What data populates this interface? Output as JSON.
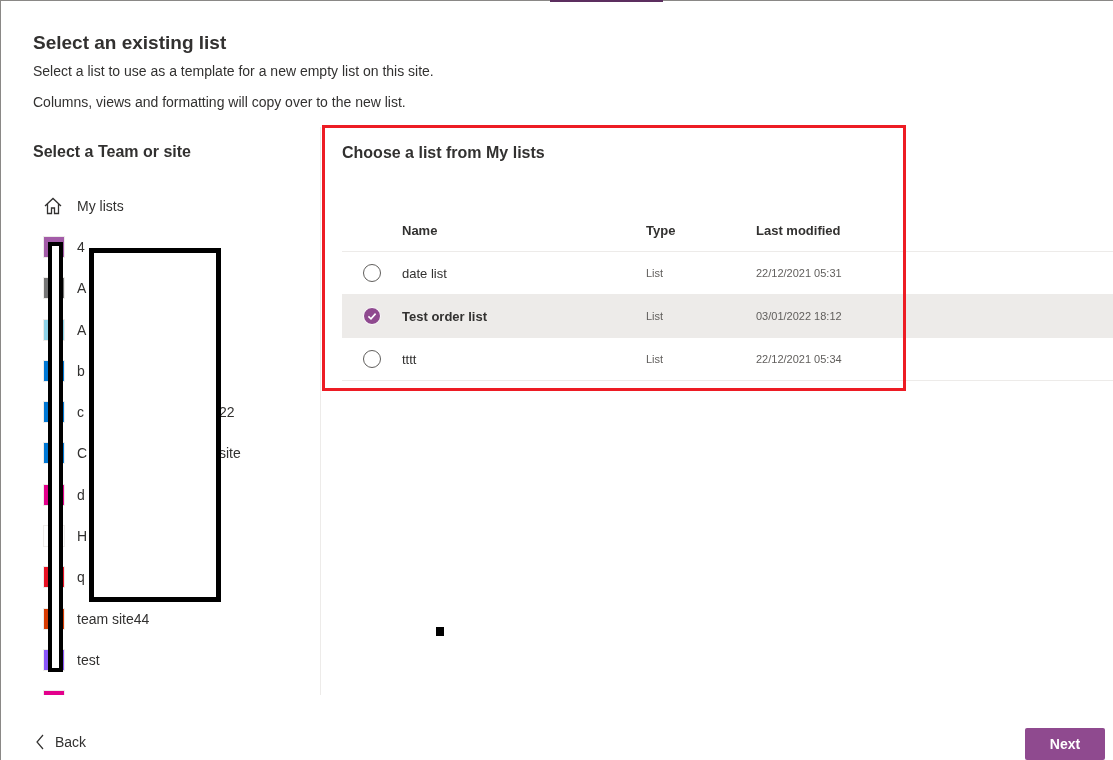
{
  "dialog": {
    "title": "Select an existing list",
    "description": [
      "Select a list to use as a template for a new empty list on this site.",
      "Columns, views and formatting will copy over to the new list."
    ],
    "site_panel": {
      "heading": "Select a Team or site",
      "items": [
        {
          "kind": "home",
          "name": "My lists"
        },
        {
          "kind": "site",
          "color": "#a35ca8",
          "name": "4"
        },
        {
          "kind": "site",
          "color": "#767676",
          "name": "A"
        },
        {
          "kind": "site",
          "color": "#8fd3e8",
          "name": "A"
        },
        {
          "kind": "site",
          "color": "#0078d4",
          "name": "b"
        },
        {
          "kind": "site",
          "color": "#0078d4",
          "name": "c",
          "name_end": "22"
        },
        {
          "kind": "site",
          "color": "#0078d4",
          "name": "C",
          "name_end": "site"
        },
        {
          "kind": "site",
          "color": "#e3008c",
          "name": "d"
        },
        {
          "kind": "site",
          "color": "#ffffff",
          "name": "H"
        },
        {
          "kind": "site",
          "color": "#e81123",
          "name": "q"
        },
        {
          "kind": "site",
          "color": "#d83b01",
          "name": "team site44"
        },
        {
          "kind": "site",
          "color": "#8a56f9",
          "name": "test"
        },
        {
          "kind": "site",
          "color": "#e3008c"
        }
      ]
    },
    "list_panel": {
      "heading": "Choose a list from My lists",
      "columns": [
        "Name",
        "Type",
        "Last modified"
      ],
      "rows": [
        {
          "selected": false,
          "name": "date list",
          "type": "List",
          "modified": "22/12/2021 05:31"
        },
        {
          "selected": true,
          "name": "Test order list",
          "type": "List",
          "modified": "03/01/2022 18:12"
        },
        {
          "selected": false,
          "name": "tttt",
          "type": "List",
          "modified": "22/12/2021 05:34"
        }
      ]
    },
    "footer": {
      "back": "Back",
      "next": "Next"
    }
  },
  "annotations": [
    {
      "kind": "highlight-frame"
    },
    {
      "kind": "redaction-box"
    },
    {
      "kind": "redaction-bar"
    },
    {
      "kind": "dot"
    }
  ]
}
